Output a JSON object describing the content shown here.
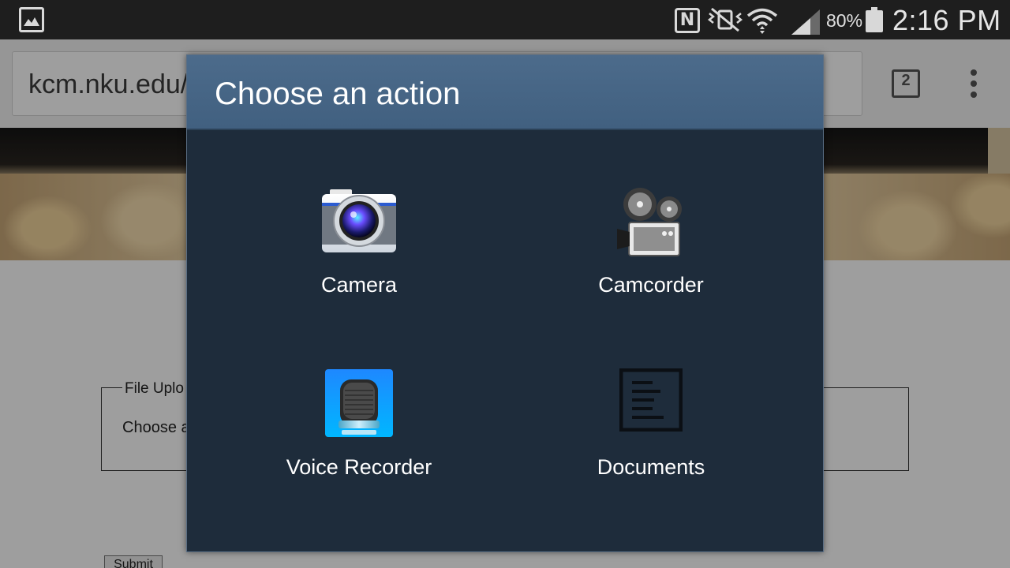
{
  "status_bar": {
    "notification_icon": "gallery-icon",
    "nfc_letter": "N",
    "battery_percent": "80%",
    "time": "2:16 PM"
  },
  "browser": {
    "url": "kcm.nku.edu/",
    "tab_count": "2"
  },
  "page": {
    "legend": "File Uplo",
    "choose_label": "Choose a",
    "submit_label": "Submit"
  },
  "dialog": {
    "title": "Choose an action",
    "options": [
      {
        "label": "Camera",
        "icon": "camera-icon"
      },
      {
        "label": "Camcorder",
        "icon": "camcorder-icon"
      },
      {
        "label": "Voice Recorder",
        "icon": "microphone-icon"
      },
      {
        "label": "Documents",
        "icon": "document-icon"
      }
    ]
  },
  "colors": {
    "dialog_header": "#4a6888",
    "dialog_body": "#1e2c3b",
    "status_bar": "#1e1e1e"
  }
}
